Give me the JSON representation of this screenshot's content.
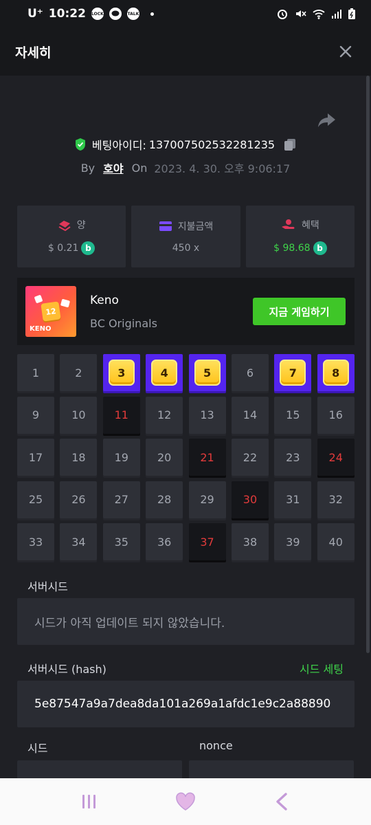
{
  "status_bar": {
    "carrier": "U⁺",
    "time": "10:22",
    "notif_label": "LOCK",
    "kakao_label": "TALK"
  },
  "header": {
    "title": "자세히"
  },
  "bet": {
    "bet_id_label": "베팅아이디:",
    "bet_id": "137007502532281235",
    "by_label": "By",
    "user": "호야",
    "on_label": "On",
    "datetime": "2023. 4. 30. 오후 9:06:17"
  },
  "stats": [
    {
      "label": "양",
      "value": "$ 0.21",
      "icon": "coins-stack-icon",
      "color": "#e0385a"
    },
    {
      "label": "지불금액",
      "value": "450 x",
      "icon": "wallet-icon",
      "color": "#7b4bff"
    },
    {
      "label": "혜택",
      "value": "$ 98.68",
      "icon": "hand-coin-icon",
      "color": "#e0385a"
    }
  ],
  "game": {
    "name": "Keno",
    "provider": "BC Originals",
    "thumb_label": "KENO",
    "thumb_number": "12",
    "play_label": "지금 게임하기"
  },
  "keno": {
    "cells": [
      {
        "n": "1",
        "state": "normal"
      },
      {
        "n": "2",
        "state": "normal"
      },
      {
        "n": "3",
        "state": "hit"
      },
      {
        "n": "4",
        "state": "hit"
      },
      {
        "n": "5",
        "state": "hit"
      },
      {
        "n": "6",
        "state": "normal"
      },
      {
        "n": "7",
        "state": "hit"
      },
      {
        "n": "8",
        "state": "hit"
      },
      {
        "n": "9",
        "state": "normal"
      },
      {
        "n": "10",
        "state": "normal"
      },
      {
        "n": "11",
        "state": "miss"
      },
      {
        "n": "12",
        "state": "normal"
      },
      {
        "n": "13",
        "state": "normal"
      },
      {
        "n": "14",
        "state": "normal"
      },
      {
        "n": "15",
        "state": "normal"
      },
      {
        "n": "16",
        "state": "normal"
      },
      {
        "n": "17",
        "state": "normal"
      },
      {
        "n": "18",
        "state": "normal"
      },
      {
        "n": "19",
        "state": "normal"
      },
      {
        "n": "20",
        "state": "normal"
      },
      {
        "n": "21",
        "state": "miss"
      },
      {
        "n": "22",
        "state": "normal"
      },
      {
        "n": "23",
        "state": "normal"
      },
      {
        "n": "24",
        "state": "miss"
      },
      {
        "n": "25",
        "state": "normal"
      },
      {
        "n": "26",
        "state": "normal"
      },
      {
        "n": "27",
        "state": "normal"
      },
      {
        "n": "28",
        "state": "normal"
      },
      {
        "n": "29",
        "state": "normal"
      },
      {
        "n": "30",
        "state": "miss"
      },
      {
        "n": "31",
        "state": "normal"
      },
      {
        "n": "32",
        "state": "normal"
      },
      {
        "n": "33",
        "state": "normal"
      },
      {
        "n": "34",
        "state": "normal"
      },
      {
        "n": "35",
        "state": "normal"
      },
      {
        "n": "36",
        "state": "normal"
      },
      {
        "n": "37",
        "state": "miss"
      },
      {
        "n": "38",
        "state": "normal"
      },
      {
        "n": "39",
        "state": "normal"
      },
      {
        "n": "40",
        "state": "normal"
      }
    ]
  },
  "seeds": {
    "server_seed_label": "서버시드",
    "server_seed_value": "시드가 아직 업데이트 되지 않았습니다.",
    "server_hash_label": "서버시드 (hash)",
    "seed_setting_label": "시드 세팅",
    "server_hash_value": "5e87547a9a7dea8da101a269a1afdc1e9c2a88890",
    "client_seed_label": "시드",
    "nonce_label": "nonce"
  },
  "colors": {
    "accent_green": "#3fc628",
    "hit_purple": "#5424ef",
    "miss_red": "#e23b3b",
    "background": "#1f2025"
  }
}
